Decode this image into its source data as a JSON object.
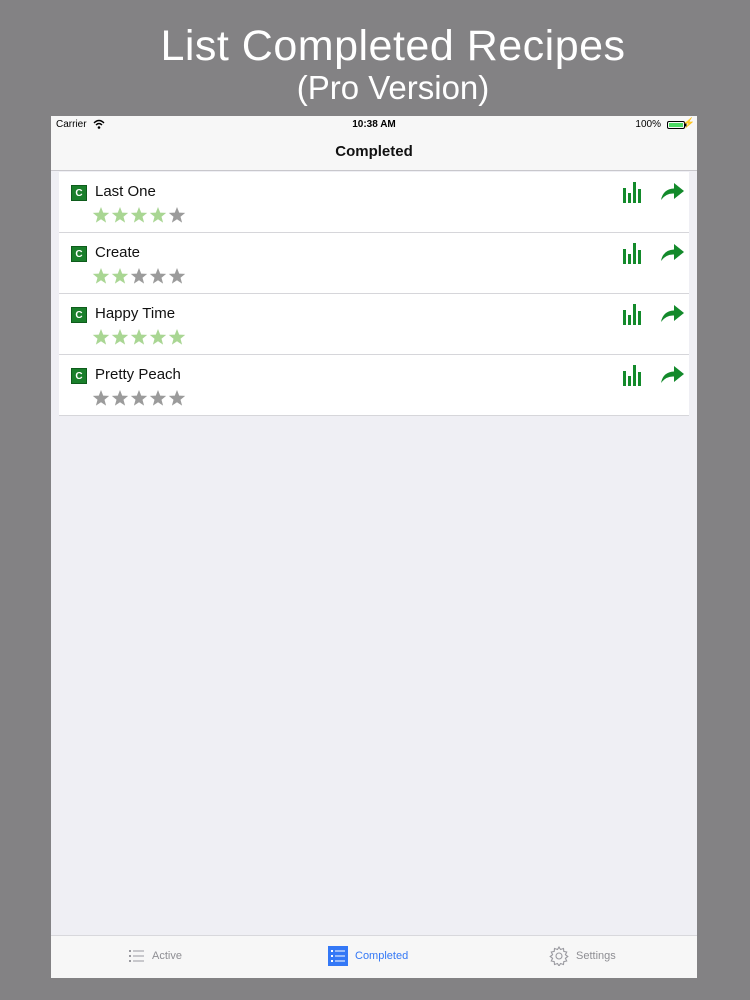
{
  "promo": {
    "title": "List Completed Recipes",
    "subtitle": "(Pro Version)"
  },
  "status_bar": {
    "carrier": "Carrier",
    "time": "10:38 AM",
    "battery": "100%"
  },
  "nav": {
    "title": "Completed"
  },
  "recipes": [
    {
      "badge": "C",
      "name": "Last One",
      "rating": 4
    },
    {
      "badge": "C",
      "name": "Create",
      "rating": 2
    },
    {
      "badge": "C",
      "name": "Happy Time",
      "rating": 5
    },
    {
      "badge": "C",
      "name": "Pretty Peach",
      "rating": 0
    }
  ],
  "tabs": {
    "active": {
      "label": "Active",
      "icon": "list-icon"
    },
    "completed": {
      "label": "Completed",
      "icon": "list-icon",
      "selected": true
    },
    "settings": {
      "label": "Settings",
      "icon": "gear-icon"
    }
  },
  "colors": {
    "accent_green": "#138a2b",
    "star_filled": "#a9d693",
    "star_empty": "#9b9b9b",
    "tab_selected": "#3478f6",
    "tab_unselected": "#8e8e93",
    "background": "#838284"
  }
}
